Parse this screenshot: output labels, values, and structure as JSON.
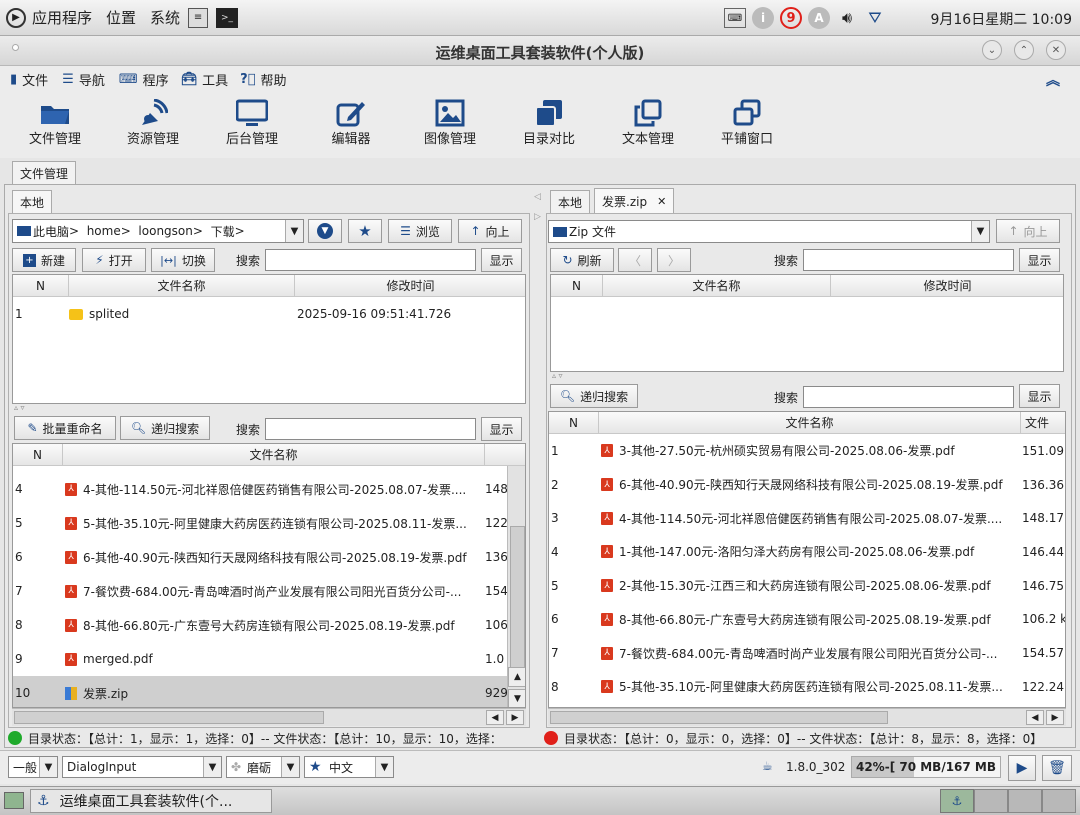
{
  "system_bar": {
    "menu_apps": "应用程序",
    "menu_places": "位置",
    "menu_system": "系统",
    "notify_count": "9",
    "notify_a": "A",
    "clock": "9月16日星期二 10:09"
  },
  "window": {
    "title": "运维桌面工具套装软件(个人版)"
  },
  "menubar": {
    "file": "文件",
    "nav": "导航",
    "program": "程序",
    "tools": "工具",
    "help": "帮助"
  },
  "toolbar": {
    "file_mgr": "文件管理",
    "resource_mgr": "资源管理",
    "backend_mgr": "后台管理",
    "editor": "编辑器",
    "image_mgr": "图像管理",
    "dir_compare": "目录对比",
    "text_mgr": "文本管理",
    "tile_window": "平铺窗口"
  },
  "main_tab": "文件管理",
  "left": {
    "tab": "本地",
    "breadcrumb": [
      "此电脑",
      "home",
      "loongson",
      "下载"
    ],
    "browse": "浏览",
    "up": "向上",
    "new": "新建",
    "open": "打开",
    "switch": "切换",
    "search_label": "搜索",
    "show": "显示",
    "top_table": {
      "headers": [
        "N",
        "文件名称",
        "修改时间"
      ],
      "rows": [
        {
          "n": "1",
          "name": "splited",
          "time": "2025-09-16 09:51:41.726"
        }
      ]
    },
    "rename": "批量重命名",
    "recursive_search": "递归搜索",
    "search_label2": "搜索",
    "show2": "显示",
    "bottom_table": {
      "headers": [
        "N",
        "文件名称"
      ],
      "rows": [
        {
          "n": "4",
          "name": "4-其他-114.50元-河北祥恩倍健医药销售有限公司-2025.08.07-发票....",
          "size": "148"
        },
        {
          "n": "5",
          "name": "5-其他-35.10元-阿里健康大药房医药连锁有限公司-2025.08.11-发票...",
          "size": "122"
        },
        {
          "n": "6",
          "name": "6-其他-40.90元-陕西知行天晟网络科技有限公司-2025.08.19-发票.pdf",
          "size": "136"
        },
        {
          "n": "7",
          "name": "7-餐饮费-684.00元-青岛啤酒时尚产业发展有限公司阳光百货分公司-...",
          "size": "154"
        },
        {
          "n": "8",
          "name": "8-其他-66.80元-广东壹号大药房连锁有限公司-2025.08.19-发票.pdf",
          "size": "106"
        },
        {
          "n": "9",
          "name": "merged.pdf",
          "size": "1.0"
        },
        {
          "n": "10",
          "name": "发票.zip",
          "size": "929"
        }
      ]
    },
    "status": "目录状态：【总计：1，显示：1，选择：0】-- 文件状态：【总计：10，显示：10，选择："
  },
  "right": {
    "tab_local": "本地",
    "tab_zip": "发票.zip",
    "location": "Zip 文件",
    "up": "向上",
    "refresh": "刷新",
    "search_label": "搜索",
    "show": "显示",
    "top_table": {
      "headers": [
        "N",
        "文件名称",
        "修改时间"
      ]
    },
    "recursive_search": "递归搜索",
    "search_label2": "搜索",
    "show2": "显示",
    "bottom_table": {
      "headers": [
        "N",
        "文件名称",
        "文件"
      ],
      "rows": [
        {
          "n": "1",
          "name": "3-其他-27.50元-杭州硕实贸易有限公司-2025.08.06-发票.pdf",
          "size": "151.09"
        },
        {
          "n": "2",
          "name": "6-其他-40.90元-陕西知行天晟网络科技有限公司-2025.08.19-发票.pdf",
          "size": "136.36"
        },
        {
          "n": "3",
          "name": "4-其他-114.50元-河北祥恩倍健医药销售有限公司-2025.08.07-发票....",
          "size": "148.17"
        },
        {
          "n": "4",
          "name": "1-其他-147.00元-洛阳匀泽大药房有限公司-2025.08.06-发票.pdf",
          "size": "146.44"
        },
        {
          "n": "5",
          "name": "2-其他-15.30元-江西三和大药房连锁有限公司-2025.08.06-发票.pdf",
          "size": "146.75"
        },
        {
          "n": "6",
          "name": "8-其他-66.80元-广东壹号大药房连锁有限公司-2025.08.19-发票.pdf",
          "size": "106.2 k"
        },
        {
          "n": "7",
          "name": "7-餐饮费-684.00元-青岛啤酒时尚产业发展有限公司阳光百货分公司-...",
          "size": "154.57"
        },
        {
          "n": "8",
          "name": "5-其他-35.10元-阿里健康大药房医药连锁有限公司-2025.08.11-发票...",
          "size": "122.24"
        }
      ]
    },
    "status": "目录状态：【总计：0，显示：0，选择：0】-- 文件状态：【总计：8，显示：8，选择：0】"
  },
  "bottom": {
    "mode": "一般",
    "font": "DialogInput",
    "theme": "磨砺",
    "lang": "中文",
    "java": "1.8.0_302",
    "memory_text": "42%-[ 70 MB/167 MB ]",
    "memory_fraction": 0.42
  },
  "taskbar": {
    "window_label": "运维桌面工具套装软件(个..."
  },
  "colors": {
    "status_green": "#1faa2b",
    "status_red": "#e0201a",
    "accent_blue": "#1e4b8a"
  }
}
